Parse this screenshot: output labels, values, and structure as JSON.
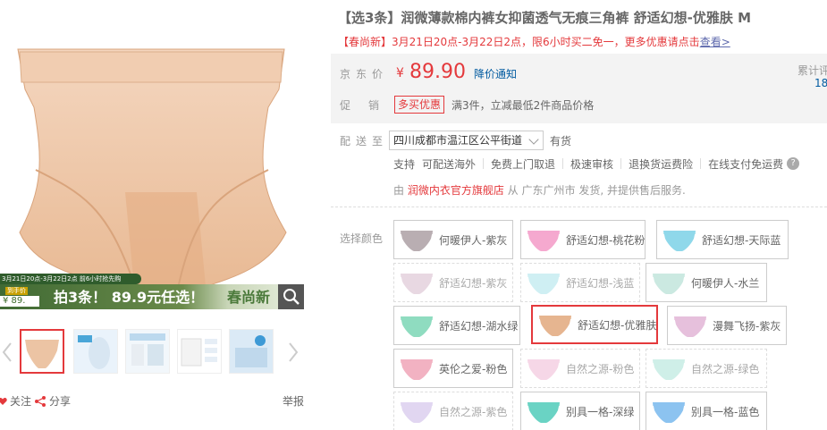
{
  "gallery": {
    "promo_small": "3月21日20点-3月22日2点 前6小时抢先购",
    "promo_price_tag": "到手价",
    "promo_price": "¥ 89.",
    "promo_main": "拍3条！ 89.9元任选！",
    "promo_brand": "春尚新",
    "actions": {
      "follow": "关注",
      "share": "分享",
      "report": "举报"
    }
  },
  "product": {
    "title": "【选3条】润微薄款棉内裤女抑菌透气无痕三角裤 舒适幻想-优雅肤 M",
    "subtitle_text": "【春尚新】3月21日20点-3月22日2点，限6小时买二免一，更多优惠请点击",
    "subtitle_link": "查看>"
  },
  "summary": {
    "price_label": "京东价",
    "currency": "¥",
    "price": "89.90",
    "price_notify": "降价通知",
    "review_label": "累计评",
    "review_count": "18",
    "promo_label": "促销",
    "promo_tag": "多买优惠",
    "promo_desc": "满3件，立减最低2件商品价格"
  },
  "shipping": {
    "label": "配送至",
    "address": "四川成都市温江区公平街道",
    "stock": "有货",
    "services_label": "支持",
    "services": [
      "可配送海外",
      "免费上门取退",
      "极速审核",
      "退换货运费险",
      "在线支付免运费"
    ],
    "help": "?",
    "seller_from": "由",
    "seller_shop": "润微内衣官方旗舰店",
    "seller_rest": "从 广东广州市 发货, 并提供售后服务."
  },
  "colors": {
    "label": "选择颜色",
    "options": [
      {
        "label": "何暖伊人-紫灰",
        "color": "#b9aeb2",
        "disabled": false,
        "selected": false
      },
      {
        "label": "舒适幻想-桃花粉",
        "color": "#f5a9cf",
        "disabled": false,
        "selected": false
      },
      {
        "label": "舒适幻想-天际蓝",
        "color": "#8fd8ea",
        "disabled": false,
        "selected": false
      },
      {
        "label": "舒适幻想-紫灰",
        "color": "#d7b9cc",
        "disabled": true,
        "selected": false
      },
      {
        "label": "舒适幻想-浅蓝",
        "color": "#a8e2ea",
        "disabled": true,
        "selected": false
      },
      {
        "label": "何暖伊人-水兰",
        "color": "#cbe9e1",
        "disabled": false,
        "selected": false
      },
      {
        "label": "舒适幻想-湖水绿",
        "color": "#8fdcc0",
        "disabled": false,
        "selected": false
      },
      {
        "label": "舒适幻想-优雅肤",
        "color": "#e6b590",
        "disabled": false,
        "selected": true
      },
      {
        "label": "漫舞飞扬-紫灰",
        "color": "#e6c0dc",
        "disabled": false,
        "selected": false
      },
      {
        "label": "英伦之爱-粉色",
        "color": "#f2b2c2",
        "disabled": false,
        "selected": false
      },
      {
        "label": "自然之源-粉色",
        "color": "#f0b8d4",
        "disabled": true,
        "selected": false
      },
      {
        "label": "自然之源-绿色",
        "color": "#a9e2d6",
        "disabled": true,
        "selected": false
      },
      {
        "label": "自然之源-紫色",
        "color": "#c9b6e6",
        "disabled": true,
        "selected": false
      },
      {
        "label": "别具一格-深绿",
        "color": "#6ad3c4",
        "disabled": false,
        "selected": false
      },
      {
        "label": "别具一格-蓝色",
        "color": "#8cc3f0",
        "disabled": false,
        "selected": false
      }
    ]
  },
  "theme": {
    "accent": "#e4393c",
    "link": "#005aa0"
  }
}
